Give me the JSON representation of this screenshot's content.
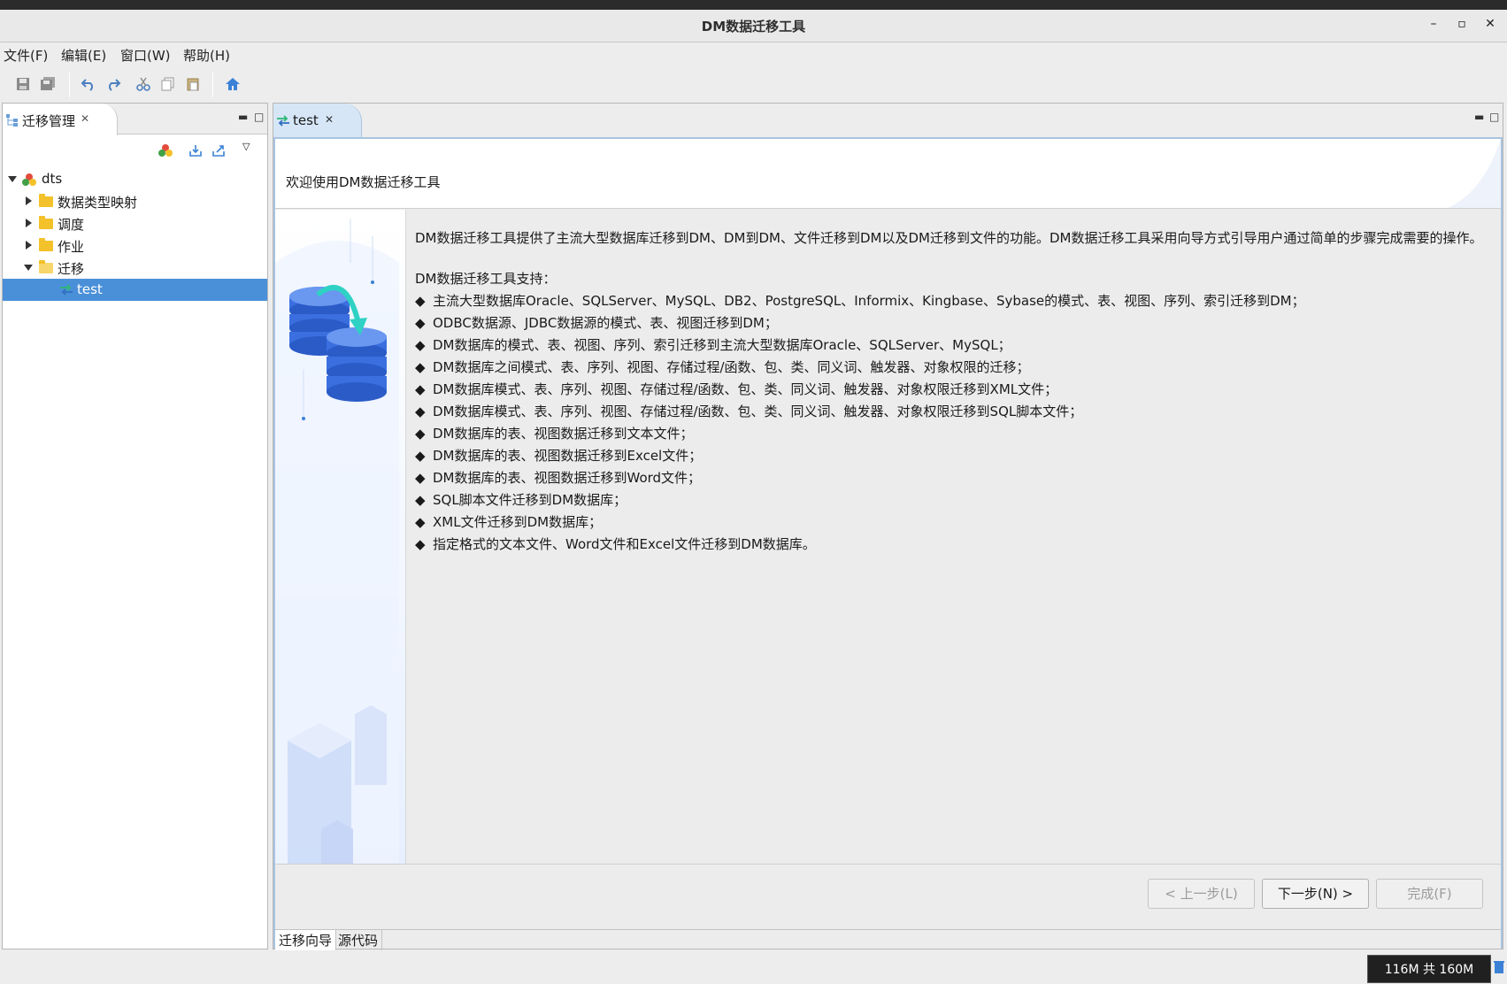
{
  "window": {
    "title": "DM数据迁移工具"
  },
  "menu": [
    "文件(F)",
    "编辑(E)",
    "窗口(W)",
    "帮助(H)"
  ],
  "left_panel": {
    "tab_label": "迁移管理",
    "tree": {
      "root": "dts",
      "items": [
        "数据类型映射",
        "调度",
        "作业",
        "迁移"
      ],
      "selected_child": "test"
    }
  },
  "editor": {
    "tab_label": "test",
    "header": "欢迎使用DM数据迁移工具",
    "intro": "DM数据迁移工具提供了主流大型数据库迁移到DM、DM到DM、文件迁移到DM以及DM迁移到文件的功能。DM数据迁移工具采用向导方式引导用户通过简单的步骤完成需要的操作。",
    "support_title": "DM数据迁移工具支持：",
    "support_items": [
      "主流大型数据库Oracle、SQLServer、MySQL、DB2、PostgreSQL、Informix、Kingbase、Sybase的模式、表、视图、序列、索引迁移到DM；",
      "ODBC数据源、JDBC数据源的模式、表、视图迁移到DM；",
      "DM数据库的模式、表、视图、序列、索引迁移到主流大型数据库Oracle、SQLServer、MySQL；",
      "DM数据库之间模式、表、序列、视图、存储过程/函数、包、类、同义词、触发器、对象权限的迁移；",
      "DM数据库模式、表、序列、视图、存储过程/函数、包、类、同义词、触发器、对象权限迁移到XML文件；",
      "DM数据库模式、表、序列、视图、存储过程/函数、包、类、同义词、触发器、对象权限迁移到SQL脚本文件；",
      "DM数据库的表、视图数据迁移到文本文件；",
      "DM数据库的表、视图数据迁移到Excel文件；",
      "DM数据库的表、视图数据迁移到Word文件；",
      "SQL脚本文件迁移到DM数据库；",
      "XML文件迁移到DM数据库；",
      "指定格式的文本文件、Word文件和Excel文件迁移到DM数据库。"
    ],
    "bullet_char": "◆",
    "buttons": {
      "prev": "< 上一步(L)",
      "next": "下一步(N) >",
      "finish": "完成(F)"
    },
    "bottom_tabs": [
      "迁移向导",
      "源代码"
    ]
  },
  "status": {
    "memory": "116M 共 160M"
  }
}
